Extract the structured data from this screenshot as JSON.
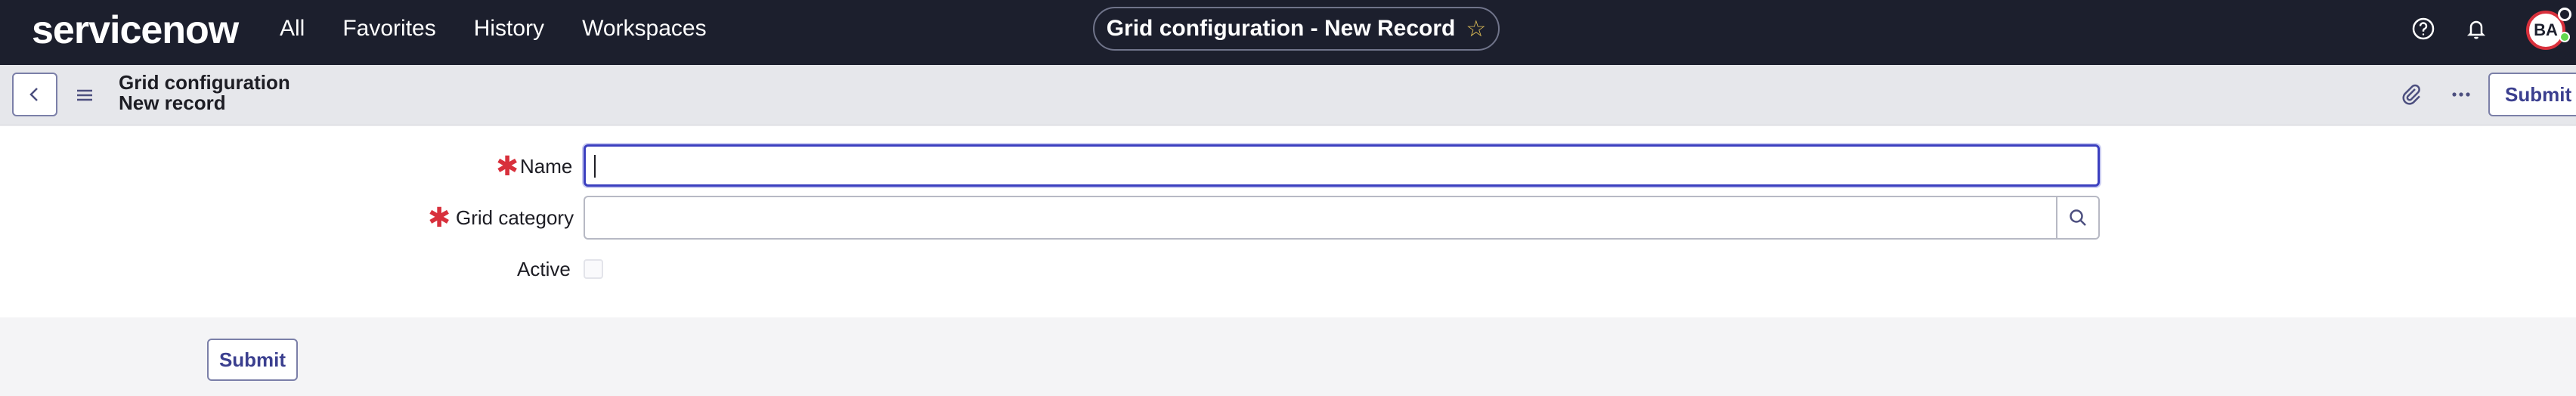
{
  "topnav": {
    "logo_text": "servicenow",
    "links": [
      "All",
      "Favorites",
      "History",
      "Workspaces"
    ],
    "title": "Grid configuration - New Record",
    "favorite_icon": "star-icon",
    "help_icon": "help-icon",
    "notifications_icon": "bell-icon",
    "avatar_initials": "BA"
  },
  "record_header": {
    "back_icon": "chevron-left-icon",
    "menu_icon": "hamburger-icon",
    "title_line1": "Grid configuration",
    "title_line2": "New record",
    "attachment_icon": "paperclip-icon",
    "more_icon": "more-icon",
    "submit_label": "Submit"
  },
  "form": {
    "name": {
      "label": "Name",
      "required_mark": "✱",
      "value": ""
    },
    "grid_category": {
      "label": "Grid category",
      "required_mark": "✱",
      "value": "",
      "lookup_icon": "search-icon"
    },
    "active": {
      "label": "Active",
      "checked": false
    }
  },
  "footer": {
    "submit_label": "Submit"
  },
  "colors": {
    "nav_bg": "#1c1f2d",
    "accent": "#3b3f8f",
    "required": "#d8303c",
    "focus_border": "#3b3fbf",
    "logo_accent": "#62d84e"
  }
}
